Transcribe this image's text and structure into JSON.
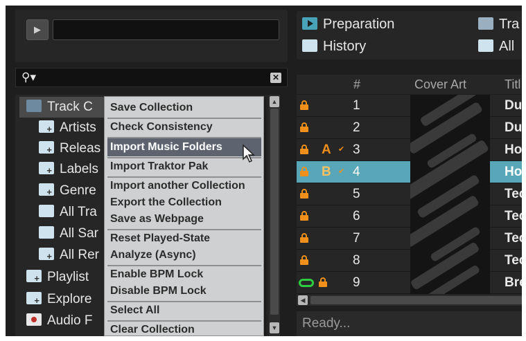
{
  "player": {
    "play_glyph": "▶"
  },
  "search": {
    "icon": "search-icon",
    "clear_glyph": "✕"
  },
  "tree": {
    "items": [
      {
        "label": "Track C",
        "icon": "track-collection-icon"
      },
      {
        "label": "Artists",
        "icon": "folder-plus-icon"
      },
      {
        "label": "Releas",
        "icon": "folder-plus-icon"
      },
      {
        "label": "Labels",
        "icon": "folder-plus-icon"
      },
      {
        "label": "Genre",
        "icon": "folder-plus-icon"
      },
      {
        "label": "All Tra",
        "icon": "folder-icon"
      },
      {
        "label": "All Sar",
        "icon": "folder-icon"
      },
      {
        "label": "All Rer",
        "icon": "folder-plus-icon"
      },
      {
        "label": "Playlist",
        "icon": "folder-plus-icon"
      },
      {
        "label": "Explore",
        "icon": "folder-plus-icon"
      },
      {
        "label": "Audio F",
        "icon": "audio-recordings-icon"
      }
    ]
  },
  "context_menu": {
    "items": [
      {
        "label": "Save Collection"
      },
      {
        "label": "Check Consistency"
      },
      {
        "label": "Import Music Folders",
        "highlighted": true
      },
      {
        "label": "Import Traktor Pak"
      },
      {
        "label": "Import another Collection"
      },
      {
        "label": "Export the Collection"
      },
      {
        "label": "Save as Webpage"
      },
      {
        "label": "Reset Played-State"
      },
      {
        "label": "Analyze (Async)"
      },
      {
        "label": "Enable BPM Lock"
      },
      {
        "label": "Disable BPM Lock"
      },
      {
        "label": "Select All"
      },
      {
        "label": "Clear Collection"
      }
    ]
  },
  "favorites": {
    "preparation": "Preparation",
    "history": "History",
    "tra": "Tra",
    "all": "All"
  },
  "list": {
    "columns": {
      "num": "#",
      "cover": "Cover Art",
      "title": "Titl"
    },
    "rows": [
      {
        "num": "1",
        "title": "Du",
        "lock": true,
        "key": "",
        "selected": false,
        "loop": false
      },
      {
        "num": "2",
        "title": "Du",
        "lock": true,
        "key": "",
        "selected": false,
        "loop": false
      },
      {
        "num": "3",
        "title": "Ho",
        "lock": true,
        "key": "A",
        "selected": false,
        "loop": false
      },
      {
        "num": "4",
        "title": "Ho",
        "lock": true,
        "key": "B",
        "selected": true,
        "loop": false
      },
      {
        "num": "5",
        "title": "Tec",
        "lock": true,
        "key": "",
        "selected": false,
        "loop": false
      },
      {
        "num": "6",
        "title": "Tec",
        "lock": true,
        "key": "",
        "selected": false,
        "loop": false
      },
      {
        "num": "7",
        "title": "Tec",
        "lock": true,
        "key": "",
        "selected": false,
        "loop": false
      },
      {
        "num": "8",
        "title": "Tec",
        "lock": true,
        "key": "",
        "selected": false,
        "loop": false
      },
      {
        "num": "9",
        "title": "Bre",
        "lock": true,
        "key": "",
        "selected": false,
        "loop": true
      }
    ]
  },
  "status": {
    "text": "Ready..."
  },
  "colors": {
    "accent_selection": "#58a7b8",
    "lock_orange": "#f0901a",
    "loop_green": "#2ecc40",
    "menu_highlight": "#5d6470"
  }
}
